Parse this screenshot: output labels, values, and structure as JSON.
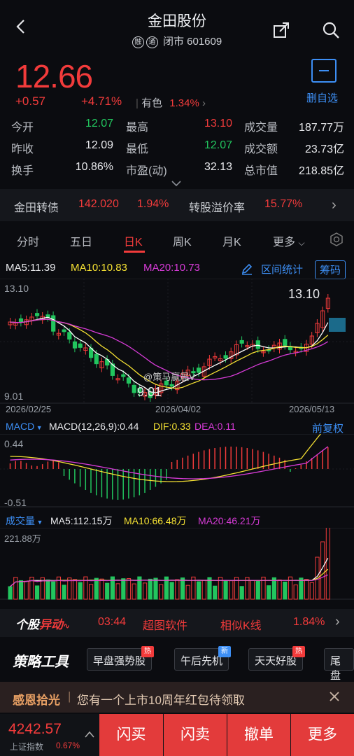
{
  "header": {
    "title": "金田股份",
    "badge1": "融",
    "badge2": "通",
    "status": "闭市 601609"
  },
  "quote": {
    "price": "12.66",
    "change": "+0.57",
    "change_pct": "+4.71%",
    "sector_label": "有色",
    "sector_pct": "1.34%",
    "remove_fav": "删自选",
    "rows": [
      {
        "l1": "今开",
        "v1": "12.07",
        "l2": "最高",
        "v2": "13.10",
        "l3": "成交量",
        "v3": "187.77万"
      },
      {
        "l1": "昨收",
        "v1": "12.09",
        "l2": "最低",
        "v2": "12.07",
        "l3": "成交额",
        "v3": "23.73亿"
      },
      {
        "l1": "换手",
        "v1": "10.86%",
        "l2": "市盈(动)",
        "v2": "32.13",
        "l3": "总市值",
        "v3": "218.85亿"
      }
    ]
  },
  "bond": {
    "name": "金田转债",
    "price": "142.020",
    "pct": "1.94%",
    "premium_label": "转股溢价率",
    "premium": "15.77%"
  },
  "tabs": [
    "分时",
    "五日",
    "日K",
    "周K",
    "月K",
    "更多"
  ],
  "ma": {
    "ma5": "MA5:11.39",
    "ma10": "MA10:10.83",
    "ma20": "MA20:10.73",
    "range_stats": "区间统计",
    "chips": "筹码"
  },
  "kline": {
    "high_axis": "13.10",
    "low_axis": "9.01",
    "high_mark": "13.10",
    "low_mark": "9.01",
    "dates": [
      "2026/02/25",
      "2026/04/02",
      "2026/05/13"
    ],
    "watermark": "@策马赢晨V"
  },
  "macd": {
    "label": "MACD",
    "params": "MACD(12,26,9):0.44",
    "dif": "DIF:0.33",
    "dea": "DEA:0.11",
    "adjust": "前复权",
    "top": "0.44",
    "bottom": "-0.51"
  },
  "volume": {
    "label": "成交量",
    "ma5": "MA5:112.15万",
    "ma10": "MA10:66.48万",
    "ma20": "MA20:46.21万",
    "top": "221.88万"
  },
  "hot": {
    "logo_a": "个股",
    "logo_b": "异动",
    "time": "03:44",
    "event": "超图软件",
    "similar": "相似K线",
    "pct": "1.84%"
  },
  "tools": {
    "title": "策略工具",
    "items": [
      {
        "label": "早盘强势股",
        "tag": "热"
      },
      {
        "label": "午后先机",
        "tag": "新"
      },
      {
        "label": "天天好股",
        "tag": "热"
      },
      {
        "label": "尾盘",
        "tag": ""
      }
    ]
  },
  "notice": {
    "title": "感恩拾光",
    "text": "您有一个上市10周年红包待领取"
  },
  "index": {
    "value": "4242.57",
    "name": "上证指数",
    "pct": "0.67%"
  },
  "trade": [
    "闪买",
    "闪卖",
    "撤单",
    "更多"
  ],
  "colors": {
    "up": "#f23b3b",
    "down": "#22c55e",
    "accent": "#3d8ff5",
    "ma5": "#ffffff",
    "ma10": "#f5e133",
    "ma20": "#d63bd6"
  }
}
